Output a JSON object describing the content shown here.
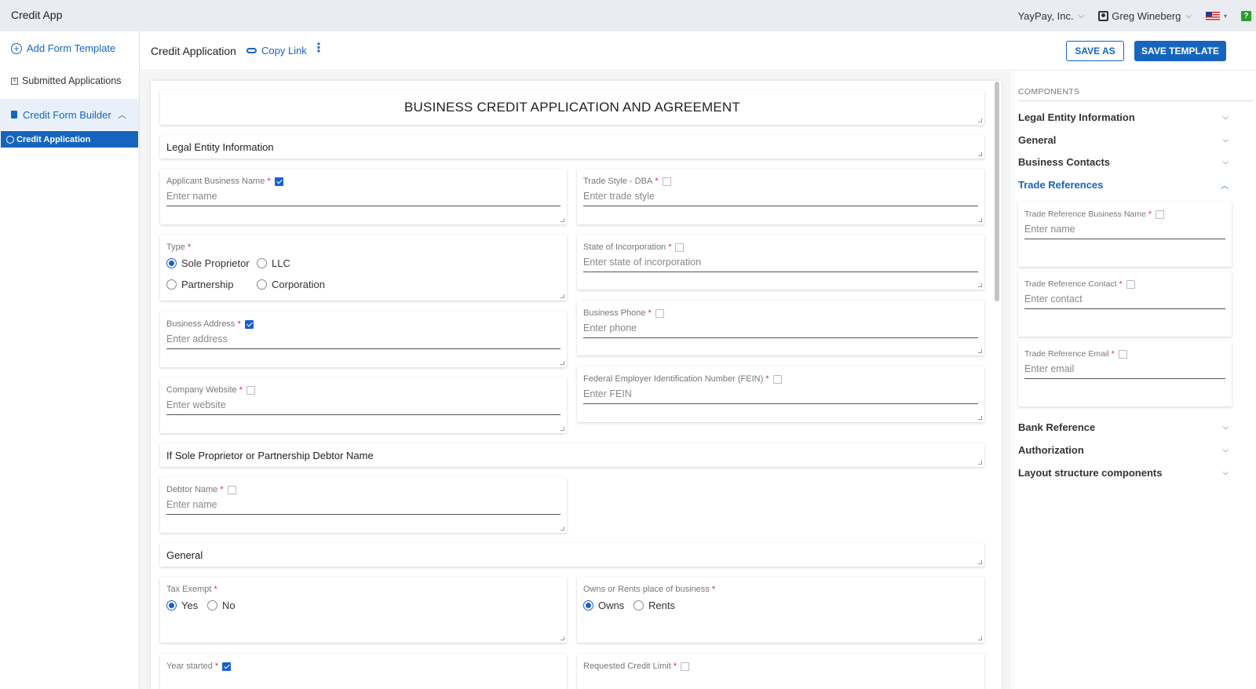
{
  "app": {
    "title": "Credit App"
  },
  "topbar": {
    "company": "YayPay, Inc.",
    "user": "Greg Wineberg",
    "help": "?"
  },
  "sidebar": {
    "add_template": "Add Form Template",
    "submitted": "Submitted Applications",
    "builder": "Credit Form Builder",
    "active_item": "Credit Application"
  },
  "header": {
    "title": "Credit Application",
    "copy_link": "Copy Link",
    "save_as": "SAVE AS",
    "save_template": "SAVE TEMPLATE"
  },
  "form": {
    "title": "BUSINESS CREDIT APPLICATION AND AGREEMENT",
    "section_legal": "Legal Entity Information",
    "section_debtor": "If Sole Proprietor or Partnership Debtor Name",
    "section_general": "General",
    "fields": {
      "applicant_name": {
        "label": "Applicant Business Name",
        "placeholder": "Enter name",
        "checked": true
      },
      "trade_style": {
        "label": "Trade Style - DBA",
        "placeholder": "Enter trade style",
        "checked": false
      },
      "type": {
        "label": "Type",
        "options": [
          "Sole Proprietor",
          "LLC",
          "Partnership",
          "Corporation"
        ],
        "selected": "Sole Proprietor"
      },
      "state_inc": {
        "label": "State of Incorporation",
        "placeholder": "Enter state of incorporation",
        "checked": false
      },
      "business_address": {
        "label": "Business Address",
        "placeholder": "Enter address",
        "checked": true
      },
      "business_phone": {
        "label": "Business Phone",
        "placeholder": "Enter phone",
        "checked": false
      },
      "company_website": {
        "label": "Company Website",
        "placeholder": "Enter website",
        "checked": false
      },
      "fein": {
        "label": "Federal Employer Identification Number (FEIN)",
        "placeholder": "Enter FEIN",
        "checked": false
      },
      "debtor_name": {
        "label": "Debtor Name",
        "placeholder": "Enter name",
        "checked": false
      },
      "tax_exempt": {
        "label": "Tax Exempt",
        "options": [
          "Yes",
          "No"
        ],
        "selected": "Yes"
      },
      "owns_rents": {
        "label": "Owns or Rents place of business",
        "options": [
          "Owns",
          "Rents"
        ],
        "selected": "Owns"
      },
      "year_started": {
        "label": "Year started",
        "checked": true
      },
      "credit_limit": {
        "label": "Requested Credit Limit",
        "checked": false
      }
    },
    "required_mark": "*"
  },
  "components": {
    "header": "COMPONENTS",
    "items": [
      "Legal Entity Information",
      "General",
      "Business Contacts",
      "Trade References",
      "Bank Reference",
      "Authorization",
      "Layout structure components"
    ],
    "open_item": "Trade References",
    "trade_fields": [
      {
        "label": "Trade Reference Business Name",
        "placeholder": "Enter name"
      },
      {
        "label": "Trade Reference Contact",
        "placeholder": "Enter contact"
      },
      {
        "label": "Trade Reference Email",
        "placeholder": "Enter email"
      }
    ]
  },
  "colors": {
    "accent": "#1565c0",
    "required": "#d32f2f",
    "topbar": "#e9ecf1"
  }
}
